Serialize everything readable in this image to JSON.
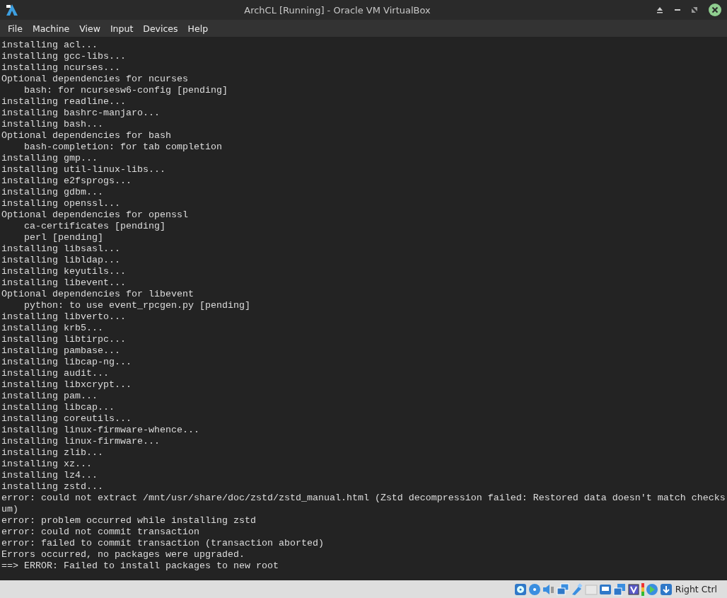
{
  "window": {
    "title": "ArchCL [Running] - Oracle VM VirtualBox"
  },
  "menu": [
    "File",
    "Machine",
    "View",
    "Input",
    "Devices",
    "Help"
  ],
  "terminal": {
    "lines": [
      "installing acl...",
      "installing gcc-libs...",
      "installing ncurses...",
      "Optional dependencies for ncurses",
      "    bash: for ncursesw6-config [pending]",
      "installing readline...",
      "installing bashrc-manjaro...",
      "installing bash...",
      "Optional dependencies for bash",
      "    bash-completion: for tab completion",
      "installing gmp...",
      "installing util-linux-libs...",
      "installing e2fsprogs...",
      "installing gdbm...",
      "installing openssl...",
      "Optional dependencies for openssl",
      "    ca-certificates [pending]",
      "    perl [pending]",
      "installing libsasl...",
      "installing libldap...",
      "installing keyutils...",
      "installing libevent...",
      "Optional dependencies for libevent",
      "    python: to use event_rpcgen.py [pending]",
      "installing libverto...",
      "installing krb5...",
      "installing libtirpc...",
      "installing pambase...",
      "installing libcap-ng...",
      "installing audit...",
      "installing libxcrypt...",
      "installing pam...",
      "installing libcap...",
      "installing coreutils...",
      "installing linux-firmware-whence...",
      "installing linux-firmware...",
      "installing zlib...",
      "installing xz...",
      "installing lz4...",
      "installing zstd...",
      "error: could not extract /mnt/usr/share/doc/zstd/zstd_manual.html (Zstd decompression failed: Restored data doesn't match checks",
      "um)",
      "error: problem occurred while installing zstd",
      "error: could not commit transaction",
      "error: failed to commit transaction (transaction aborted)",
      "Errors occurred, no packages were upgraded.",
      "==> ERROR: Failed to install packages to new root"
    ]
  },
  "status_bar": {
    "host_key": "Right Ctrl"
  }
}
